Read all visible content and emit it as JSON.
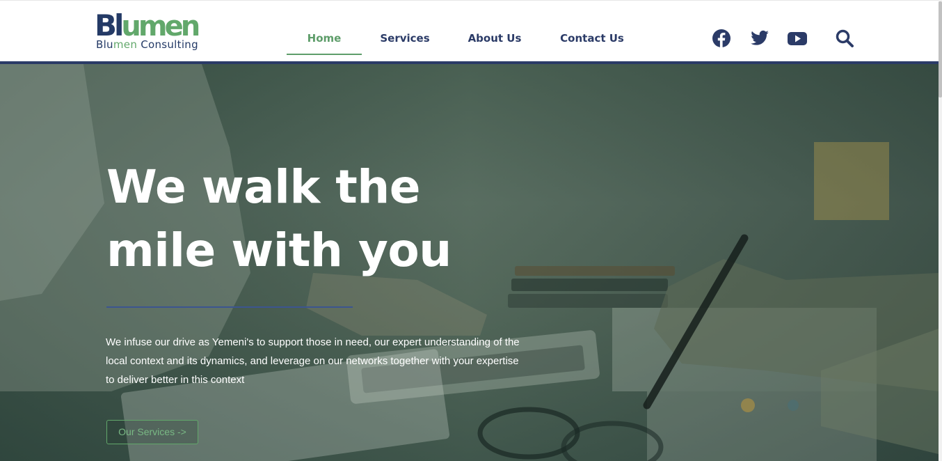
{
  "logo": {
    "mark_part1": "Bl",
    "mark_part2": "umen",
    "subtitle_part1": "Blu",
    "subtitle_part2": "men",
    "subtitle_part3": " Consulting"
  },
  "nav": {
    "items": [
      {
        "label": "Home",
        "active": true
      },
      {
        "label": "Services",
        "active": false
      },
      {
        "label": "About Us",
        "active": false
      },
      {
        "label": "Contact Us",
        "active": false
      }
    ]
  },
  "social": {
    "icons": [
      "facebook-icon",
      "twitter-icon",
      "youtube-icon",
      "search-icon"
    ]
  },
  "hero": {
    "title_line1": "We walk the",
    "title_line2": "mile with you",
    "description": "We infuse our drive as Yemeni's to support those in need, our expert understanding of the local context and its dynamics, and leverage on our networks together with your expertise to deliver better in this context",
    "cta_label": "Our Services ->"
  },
  "colors": {
    "navy": "#2b3b67",
    "green": "#5e9d6a",
    "hero_overlay": "#223a32",
    "white": "#ffffff"
  }
}
